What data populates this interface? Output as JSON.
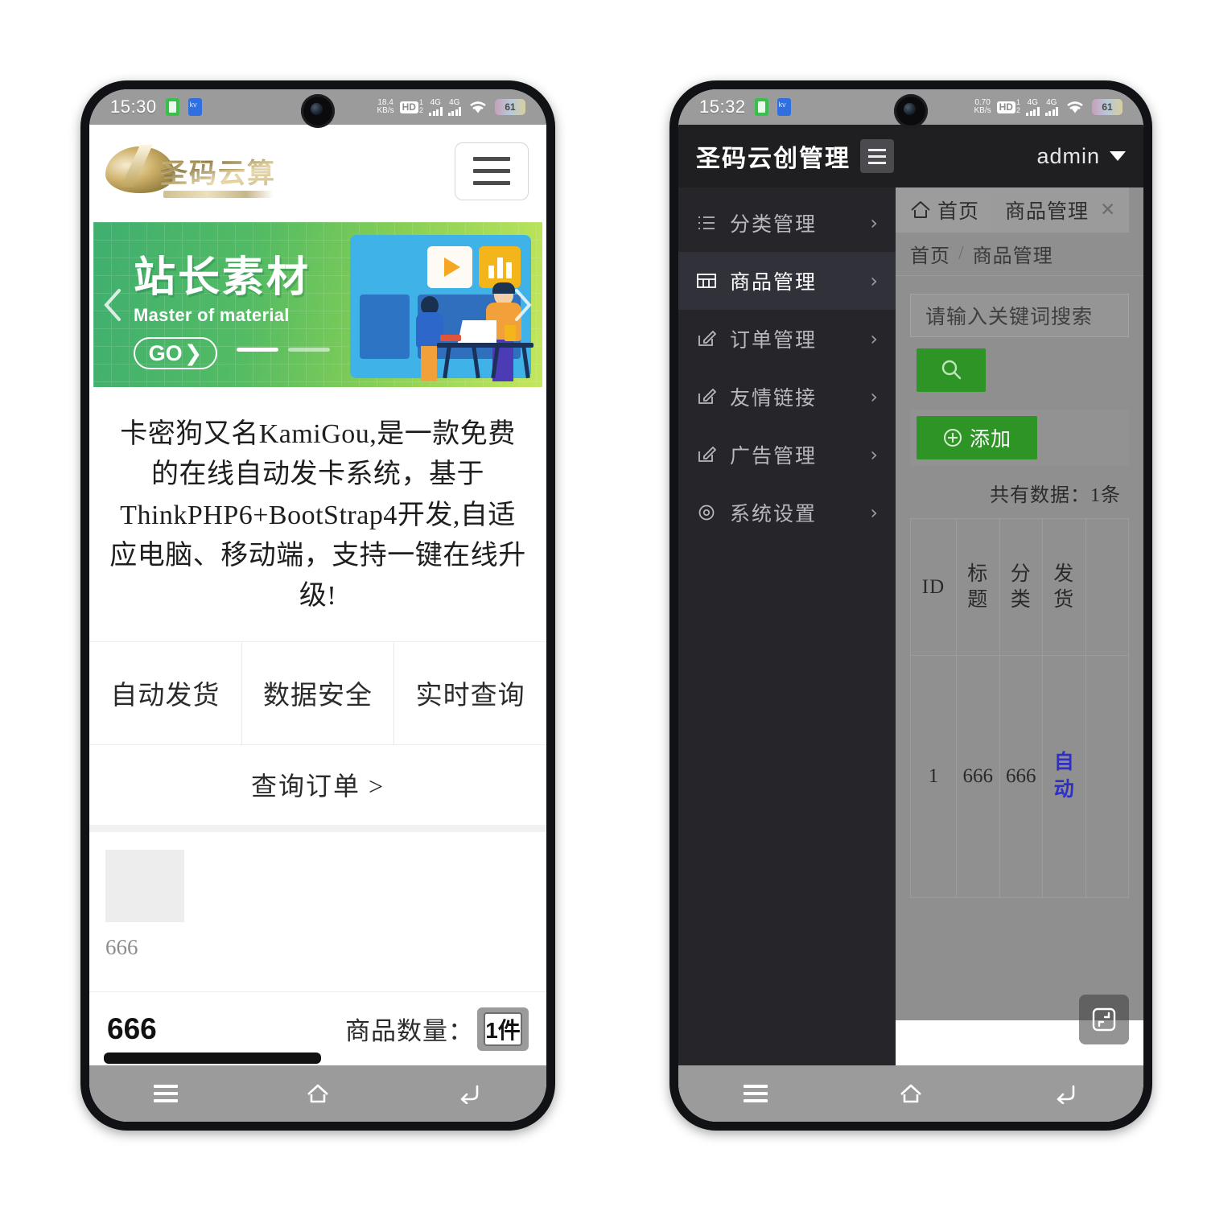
{
  "left_phone": {
    "status_bar": {
      "time": "15:30",
      "net_speed": "18.4",
      "net_speed_unit": "KB/s",
      "hd_label": "HD",
      "sim1": "1",
      "sim2": "2",
      "net_type_1": "4G",
      "net_type_2": "4G",
      "battery": "61"
    },
    "site": {
      "logo_text": "圣码云算",
      "banner": {
        "title_cn": "站长素材",
        "title_en": "Master of material",
        "cta": "GO",
        "cta_arrow": "❯"
      },
      "description": "卡密狗又名KamiGou,是一款免费的在线自动发卡系统，基于ThinkPHP6+BootStrap4开发,自适应电脑、移动端，支持一键在线升级!",
      "features": [
        "自动发货",
        "数据安全",
        "实时查询"
      ],
      "query_orders": "查询订单 >",
      "product": {
        "name": "666"
      },
      "bottom_bar": {
        "product_name": "666",
        "qty_label": "商品数量：",
        "qty_value": "1件"
      }
    },
    "nav_bar": {
      "menu": "menu",
      "home": "home",
      "back": "back"
    }
  },
  "right_phone": {
    "status_bar": {
      "time": "15:32",
      "net_speed": "0.70",
      "net_speed_unit": "KB/s",
      "hd_label": "HD",
      "sim1": "1",
      "sim2": "2",
      "net_type_1": "4G",
      "net_type_2": "4G",
      "battery": "61"
    },
    "admin": {
      "app_title": "圣码云创管理",
      "user": "admin",
      "sidebar": [
        {
          "label": "分类管理",
          "icon": "list-icon",
          "arrow": "›",
          "active": false
        },
        {
          "label": "商品管理",
          "icon": "grid-icon",
          "arrow": "›",
          "active": true
        },
        {
          "label": "订单管理",
          "icon": "edit-icon",
          "arrow": "›",
          "active": false
        },
        {
          "label": "友情链接",
          "icon": "edit-icon",
          "arrow": "›",
          "active": false
        },
        {
          "label": "广告管理",
          "icon": "edit-icon",
          "arrow": "›",
          "active": false
        },
        {
          "label": "系统设置",
          "icon": "gear-icon",
          "arrow": "›",
          "active": false
        }
      ],
      "tabs": [
        {
          "label": "首页",
          "icon": "home-icon",
          "closable": false
        },
        {
          "label": "商品管理",
          "icon": "",
          "closable": true,
          "close": "✕"
        }
      ],
      "breadcrumb": {
        "root": "首页",
        "sep": "/",
        "current": "商品管理"
      },
      "search": {
        "placeholder": "请输入关键词搜索",
        "value": ""
      },
      "add_button": {
        "label": "添加",
        "plus": "＋"
      },
      "total_count": "共有数据：1条",
      "table": {
        "columns": [
          "ID",
          "标题",
          "分类",
          "发货"
        ],
        "rows": [
          {
            "id": "1",
            "title": "666",
            "category": "666",
            "delivery": "自动"
          }
        ]
      },
      "fullscreen_button": "fullscreen-icon"
    },
    "nav_bar": {
      "menu": "menu",
      "home": "home",
      "back": "back"
    }
  },
  "colors": {
    "brand_green": "#2d9425",
    "banner_green_start": "#3faf6f",
    "banner_green_end": "#c4e75b",
    "admin_dark": "#1f1f22",
    "sidebar_bg": "#26262a",
    "sidebar_active": "#31313a",
    "link_blue": "#2f2fc7",
    "statusbar_gray": "#9b9b9b"
  }
}
